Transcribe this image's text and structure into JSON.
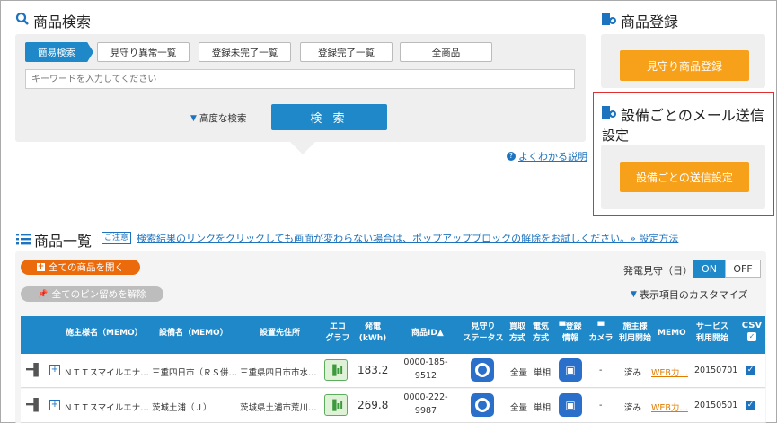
{
  "search": {
    "title": "商品検索",
    "tabs": [
      "簡易検索",
      "見守り異常一覧",
      "登録未完了一覧",
      "登録完了一覧",
      "全商品"
    ],
    "placeholder": "キーワードを入力してください",
    "advanced": "高度な検索",
    "search_button": "検 索",
    "help_link": "よくわかる説明"
  },
  "register": {
    "title": "商品登録",
    "button": "見守り商品登録"
  },
  "mail": {
    "title_line1": "設備ごとのメール送信",
    "title_line2": "設定",
    "button": "設備ごとの送信設定"
  },
  "list": {
    "title": "商品一覧",
    "notice_badge": "ご注意",
    "notice_text": "検索結果のリンクをクリックしても画面が変わらない場合は、ポップアップブロックの解除をお試しください。» 設定方法",
    "open_all": "全ての商品を開く",
    "unpin_all": "全てのピン留めを解除",
    "power_watch_label": "発電見守（日）",
    "toggle_on": "ON",
    "toggle_off": "OFF",
    "customize": "表示項目のカスタマイズ",
    "headers": {
      "owner": "施主様名（MEMO）",
      "equipment": "設備名（MEMO）",
      "location": "設置先住所",
      "eco1": "エコ",
      "eco2": "グラフ",
      "gen1": "発電",
      "gen2": "(kWh)",
      "product_id": "商品ID▲",
      "watch1": "見守り",
      "watch2": "ステータス",
      "buy1": "買取",
      "buy2": "方式",
      "elec1": "電気",
      "elec2": "方式",
      "reg1": "登録",
      "reg2": "情報",
      "cam": "カメラ",
      "owner_use1": "施主様",
      "owner_use2": "利用開始",
      "memo": "MEMO",
      "service1": "サービス",
      "service2": "利用開始",
      "csv": "CSV"
    },
    "rows": [
      {
        "owner": "ＮＴＴスマイルエナ…",
        "equipment": "三重四日市（ＲＳ併…",
        "location": "三重県四日市市水…",
        "generation": "183.2",
        "id1": "0000-185-",
        "id2": "9512",
        "buy": "全量",
        "elec": "単相",
        "camera": "-",
        "owner_use": "済み",
        "memo": "WEB力…",
        "service": "20150701"
      },
      {
        "owner": "ＮＴＴスマイルエナ…",
        "equipment": "茨城土浦（Ｊ）",
        "location": "茨城県土浦市荒川…",
        "generation": "269.8",
        "id1": "0000-222-",
        "id2": "9987",
        "buy": "全量",
        "elec": "単相",
        "camera": "-",
        "owner_use": "済み",
        "memo": "WEB力…",
        "service": "20150501"
      }
    ]
  }
}
